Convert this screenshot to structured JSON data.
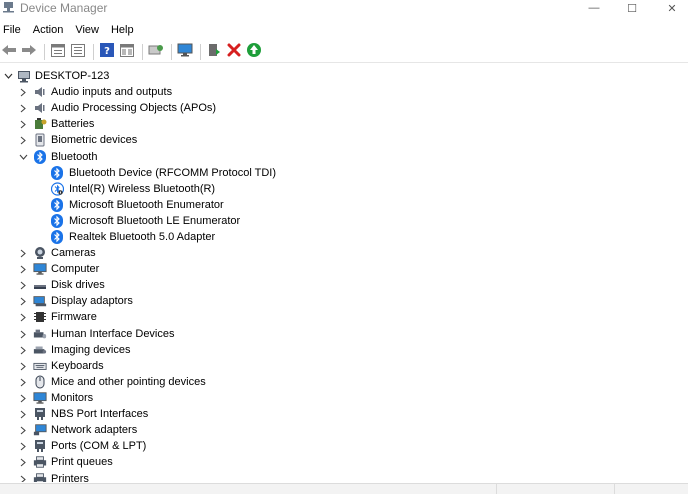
{
  "window": {
    "title": "Device Manager",
    "buttons": {
      "minimize": "—",
      "maximize": "☐",
      "close": "✕"
    }
  },
  "menu": [
    "File",
    "Action",
    "View",
    "Help"
  ],
  "toolbar": {
    "buttons": [
      "back-icon",
      "forward-icon",
      "properties-icon",
      "list-icon",
      "help-icon",
      "view-icon",
      "scan-icon",
      "monitor-icon",
      "update-driver-icon",
      "uninstall-icon",
      "enable-icon"
    ]
  },
  "tree": {
    "root": "DESKTOP-123",
    "items": [
      {
        "label": "Audio inputs and outputs",
        "icon": "speaker-icon",
        "expanded": false
      },
      {
        "label": "Audio Processing Objects (APOs)",
        "icon": "speaker-icon",
        "expanded": false
      },
      {
        "label": "Batteries",
        "icon": "battery-icon",
        "expanded": false
      },
      {
        "label": "Biometric devices",
        "icon": "biometric-icon",
        "expanded": false
      },
      {
        "label": "Bluetooth",
        "icon": "bluetooth-icon",
        "expanded": true,
        "children": [
          {
            "label": "Bluetooth Device (RFCOMM Protocol TDI)",
            "icon": "bluetooth-icon"
          },
          {
            "label": "Intel(R) Wireless Bluetooth(R)",
            "icon": "bluetooth-disabled-icon"
          },
          {
            "label": "Microsoft Bluetooth Enumerator",
            "icon": "bluetooth-icon"
          },
          {
            "label": "Microsoft Bluetooth LE Enumerator",
            "icon": "bluetooth-icon"
          },
          {
            "label": "Realtek Bluetooth 5.0 Adapter",
            "icon": "bluetooth-icon"
          }
        ]
      },
      {
        "label": "Cameras",
        "icon": "camera-icon",
        "expanded": false
      },
      {
        "label": "Computer",
        "icon": "computer-icon",
        "expanded": false
      },
      {
        "label": "Disk drives",
        "icon": "disk-icon",
        "expanded": false
      },
      {
        "label": "Display adaptors",
        "icon": "display-adapter-icon",
        "expanded": false
      },
      {
        "label": "Firmware",
        "icon": "firmware-icon",
        "expanded": false
      },
      {
        "label": "Human Interface Devices",
        "icon": "hid-icon",
        "expanded": false
      },
      {
        "label": "Imaging devices",
        "icon": "imaging-icon",
        "expanded": false
      },
      {
        "label": "Keyboards",
        "icon": "keyboard-icon",
        "expanded": false
      },
      {
        "label": "Mice and other pointing devices",
        "icon": "mouse-icon",
        "expanded": false
      },
      {
        "label": "Monitors",
        "icon": "monitor-icon",
        "expanded": false
      },
      {
        "label": "NBS Port Interfaces",
        "icon": "port-icon",
        "expanded": false
      },
      {
        "label": "Network adapters",
        "icon": "network-icon",
        "expanded": false
      },
      {
        "label": "Ports (COM & LPT)",
        "icon": "port-icon",
        "expanded": false
      },
      {
        "label": "Print queues",
        "icon": "printer-icon",
        "expanded": false
      },
      {
        "label": "Printers",
        "icon": "printer-icon",
        "expanded": false
      }
    ]
  },
  "colors": {
    "bluetooth": "#1a73e8",
    "uninstall": "#d61f1f",
    "enable": "#1e9e3a",
    "monitor": "#2f86d6"
  }
}
